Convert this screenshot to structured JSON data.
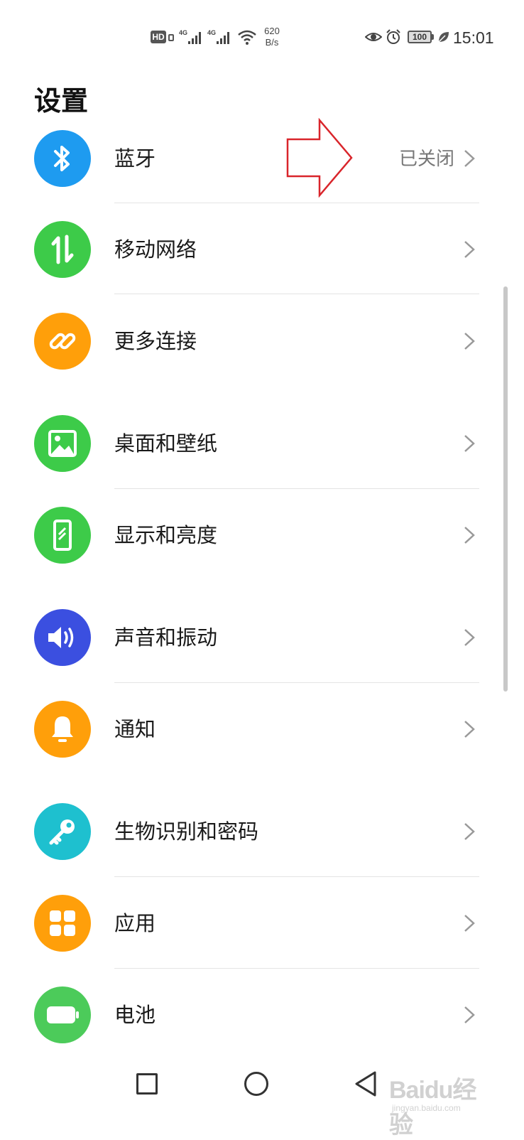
{
  "status_bar": {
    "hd_label": "HD",
    "network_1": "4G",
    "network_2": "4G",
    "speed_value": "620",
    "speed_unit": "B/s",
    "battery_level": "100",
    "time": "15:01",
    "icons": [
      "hd-icon",
      "signal-icon",
      "wifi-icon",
      "eye-icon",
      "alarm-icon",
      "battery-icon",
      "leaf-icon"
    ]
  },
  "page": {
    "title": "设置"
  },
  "settings": [
    {
      "label": "蓝牙",
      "value": "已关闭",
      "icon": "bluetooth-icon",
      "color": "#1E9BF0"
    },
    {
      "label": "移动网络",
      "value": "",
      "icon": "mobile-network-icon",
      "color": "#3DCB49"
    },
    {
      "label": "更多连接",
      "value": "",
      "icon": "link-icon",
      "color": "#FF9F0A"
    },
    {
      "label": "桌面和壁纸",
      "value": "",
      "icon": "wallpaper-icon",
      "color": "#3DCB49"
    },
    {
      "label": "显示和亮度",
      "value": "",
      "icon": "display-icon",
      "color": "#3DCB49"
    },
    {
      "label": "声音和振动",
      "value": "",
      "icon": "sound-icon",
      "color": "#3B4FE0"
    },
    {
      "label": "通知",
      "value": "",
      "icon": "bell-icon",
      "color": "#FF9F0A"
    },
    {
      "label": "生物识别和密码",
      "value": "",
      "icon": "key-icon",
      "color": "#1EC0CF"
    },
    {
      "label": "应用",
      "value": "",
      "icon": "apps-icon",
      "color": "#FF9F0A"
    },
    {
      "label": "电池",
      "value": "",
      "icon": "battery-icon",
      "color": "#4CCB5A"
    }
  ],
  "annotation": {
    "color": "#D9252B",
    "icon": "right-arrow-icon"
  },
  "nav_bar": {
    "icons": [
      "recent-apps-icon",
      "home-icon",
      "back-icon"
    ]
  },
  "watermark": {
    "main": "Baidu经验",
    "sub": "jingyan.baidu.com"
  }
}
